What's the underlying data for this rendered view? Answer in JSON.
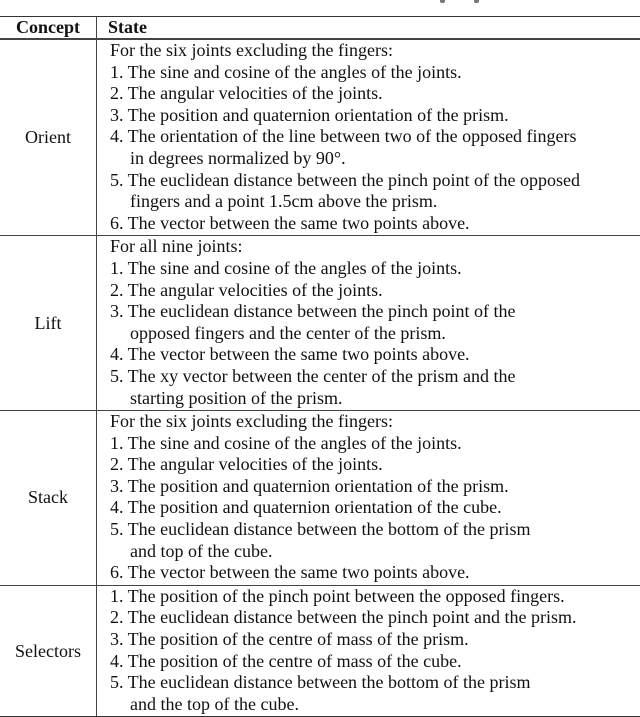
{
  "table": {
    "headers": {
      "concept": "Concept",
      "state": "State"
    },
    "rows": [
      {
        "concept": "Orient",
        "lines": [
          {
            "text": "For the six joints excluding the fingers:",
            "indent": false
          },
          {
            "text": "1. The sine and cosine of the angles of the joints.",
            "indent": false
          },
          {
            "text": "2. The angular velocities of the joints.",
            "indent": false
          },
          {
            "text": "3. The position and quaternion orientation of the prism.",
            "indent": false
          },
          {
            "text": "4. The orientation of the line between two of the opposed fingers",
            "indent": false
          },
          {
            "text": "in degrees normalized by 90°.",
            "indent": true
          },
          {
            "text": "5. The euclidean distance between the pinch point of the opposed",
            "indent": false
          },
          {
            "text": "fingers and a point 1.5cm above the prism.",
            "indent": true
          },
          {
            "text": "6. The vector between the same two points above.",
            "indent": false
          }
        ]
      },
      {
        "concept": "Lift",
        "lines": [
          {
            "text": "For all nine joints:",
            "indent": false
          },
          {
            "text": "1. The sine and cosine of the angles of the joints.",
            "indent": false
          },
          {
            "text": "2. The angular velocities of the joints.",
            "indent": false
          },
          {
            "text": "3. The euclidean distance between the pinch point of the",
            "indent": false
          },
          {
            "text": "opposed fingers and the center of the prism.",
            "indent": true
          },
          {
            "text": "4. The vector between the same two points above.",
            "indent": false
          },
          {
            "text": "5. The xy vector between the center of the prism and the",
            "indent": false
          },
          {
            "text": "starting position of the prism.",
            "indent": true
          }
        ]
      },
      {
        "concept": "Stack",
        "lines": [
          {
            "text": "For the six joints excluding the fingers:",
            "indent": false
          },
          {
            "text": "1. The sine and cosine of the angles of the joints.",
            "indent": false
          },
          {
            "text": "2. The angular velocities of the joints.",
            "indent": false
          },
          {
            "text": "3. The position and quaternion orientation of the prism.",
            "indent": false
          },
          {
            "text": "4. The position and quaternion orientation of the cube.",
            "indent": false
          },
          {
            "text": "5. The euclidean distance between the bottom of the prism",
            "indent": false
          },
          {
            "text": "and top of the cube.",
            "indent": true
          },
          {
            "text": "6. The vector between the same two points above.",
            "indent": false
          }
        ]
      },
      {
        "concept": "Selectors",
        "lines": [
          {
            "text": "1. The position of the pinch point between the opposed fingers.",
            "indent": false
          },
          {
            "text": "2. The euclidean distance between the pinch point and the prism.",
            "indent": false
          },
          {
            "text": "3. The position of the centre of mass of the prism.",
            "indent": false
          },
          {
            "text": "4. The position of the centre of mass of the cube.",
            "indent": false
          },
          {
            "text": "5. The euclidean distance between the bottom of the prism",
            "indent": false
          },
          {
            "text": "and the top of the cube.",
            "indent": true
          }
        ]
      }
    ]
  }
}
